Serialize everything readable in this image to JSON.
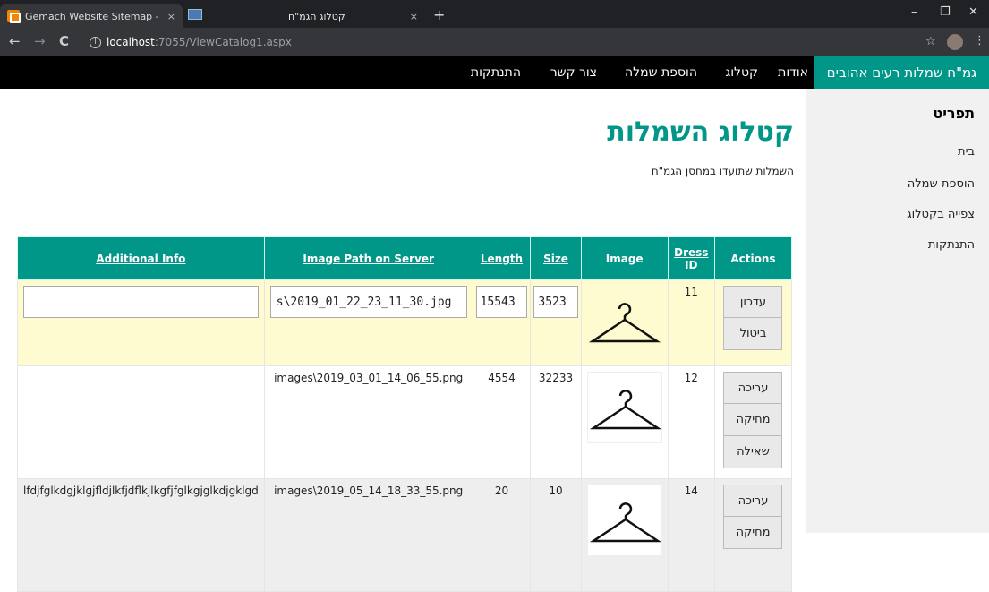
{
  "browser": {
    "tab1_title": "Gemach Website Sitemap - draw",
    "tab2_title": "קטלוג הגמ\"ח",
    "close": "×",
    "new_tab": "+",
    "win_min": "–",
    "win_max": "❐",
    "win_close": "✕",
    "url_host": "localhost",
    "url_rest": ":7055/ViewCatalog1.aspx",
    "back": "←",
    "forward": "→",
    "reload": "C",
    "star": "☆",
    "menu": "⋮"
  },
  "nav": {
    "brand": "גמ\"ח שמלות רעים אהובים",
    "links": [
      "אודות",
      "קטלוג",
      "הוספת שמלה",
      "צור קשר",
      "התנתקות"
    ]
  },
  "sidebar": {
    "title": "תפריט",
    "items": [
      "בית",
      "הוספת שמלה",
      "צפייה בקטלוג",
      "התנתקות"
    ]
  },
  "page": {
    "title": "קטלוג השמלות",
    "subtitle": "השמלות שתועדו במחסן הגמ\"ח"
  },
  "table": {
    "headers": [
      "Additional Info",
      "Image Path on Server",
      "Length",
      "Size",
      "Image",
      "Dress ID",
      "Actions"
    ],
    "edit_row": {
      "info_value": "",
      "path_value": "s\\2019_01_22_23_11_30.jpg",
      "length_value": "15543",
      "size_value": "3523",
      "id": "11",
      "actions": [
        "עדכון",
        "ביטול"
      ]
    },
    "rows": [
      {
        "info": "",
        "path": "images\\2019_03_01_14_06_55.png",
        "length": "4554",
        "size": "32233",
        "id": "12",
        "actions": [
          "עריכה",
          "מחיקה",
          "שאילה"
        ]
      },
      {
        "info": "lfdjfglkdgjklgjfldjlkfjdflkjlkgfjfglkgjglkdjgklgd",
        "path": "images\\2019_05_14_18_33_55.png",
        "length": "20",
        "size": "10",
        "id": "14",
        "actions": [
          "עריכה",
          "מחיקה"
        ]
      }
    ]
  }
}
